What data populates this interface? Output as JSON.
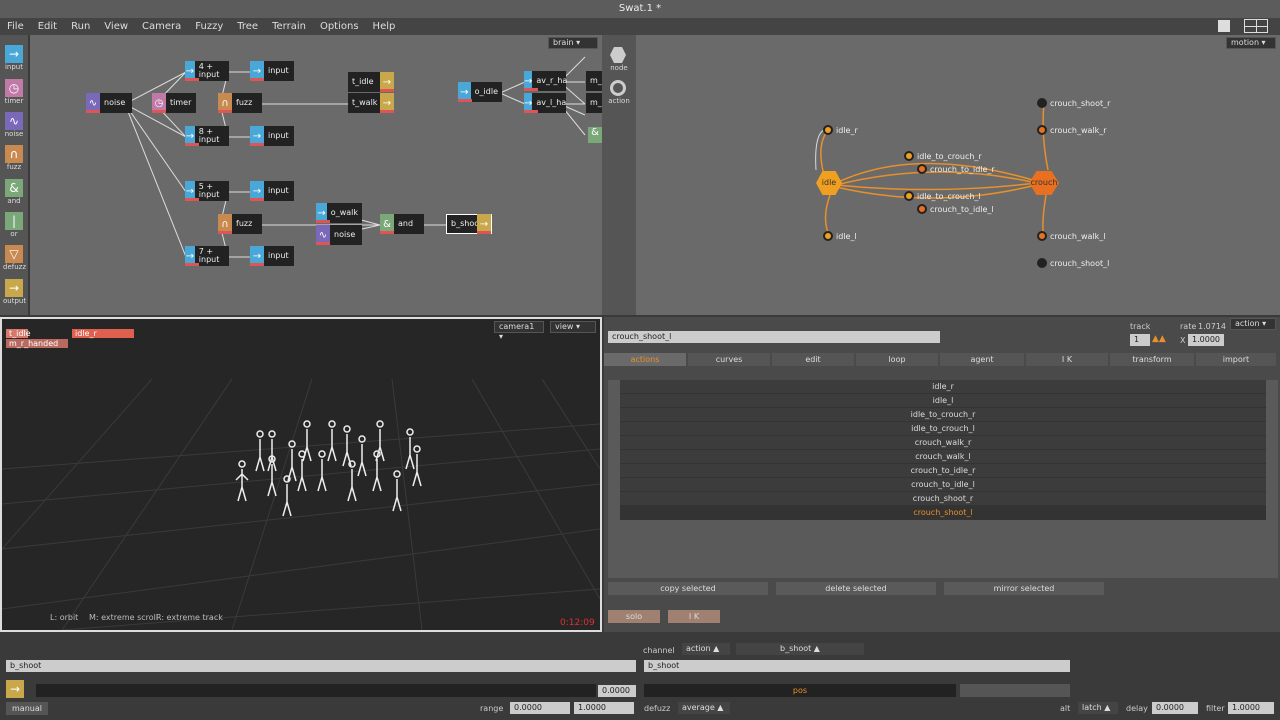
{
  "window": {
    "title": "Swat.1 *"
  },
  "menu": [
    "File",
    "Edit",
    "Run",
    "View",
    "Camera",
    "Fuzzy",
    "Tree",
    "Terrain",
    "Options",
    "Help"
  ],
  "tools": [
    {
      "label": "input",
      "icon": "arrow-right-icon"
    },
    {
      "label": "timer",
      "icon": "clock-icon"
    },
    {
      "label": "noise",
      "icon": "wave-icon"
    },
    {
      "label": "fuzz",
      "icon": "bell-curve-icon"
    },
    {
      "label": "and",
      "icon": "ampersand-icon"
    },
    {
      "label": "or",
      "icon": "bar-icon"
    },
    {
      "label": "defuzz",
      "icon": "triangle-down-icon"
    },
    {
      "label": "output",
      "icon": "arrow-right-icon"
    }
  ],
  "brain": {
    "dropdown": "brain",
    "nodes": {
      "noise": "noise",
      "timer": "timer",
      "in4": "4 + input",
      "in8": "8 + input",
      "in5": "5 + input",
      "in7": "7 + input",
      "input": "input",
      "fuzz": "fuzz",
      "t_idle": "t_idle",
      "t_walk": "t_walk",
      "o_idle": "o_idle",
      "av_r": "av_r_ha",
      "av_l": "av_l_ha",
      "m": "m_",
      "o_walk": "o_walk",
      "noise2": "noise",
      "and": "and",
      "b_shoot": "b_shoot"
    }
  },
  "side_tools": {
    "node": "node",
    "action": "action"
  },
  "motion": {
    "dropdown": "motion",
    "nodes": {
      "idle": "idle",
      "crouch": "crouch",
      "idle_r": "idle_r",
      "idle_l": "idle_l",
      "idle_to_crouch_r": "idle_to_crouch_r",
      "crouch_to_idle_r": "crouch_to_idle_r",
      "idle_to_crouch_l": "idle_to_crouch_l",
      "crouch_to_idle_l": "crouch_to_idle_l",
      "crouch_shoot_r": "crouch_shoot_r",
      "crouch_walk_r": "crouch_walk_r",
      "crouch_walk_l": "crouch_walk_l",
      "crouch_shoot_l": "crouch_shoot_l"
    }
  },
  "viewport": {
    "tags": [
      "t_idle",
      "idle_r",
      "m_r_handed"
    ],
    "camera": "camera1",
    "view": "view",
    "hint_orbit": "L: orbit",
    "hint_scroll": "M: extreme scroll",
    "hint_track": "R: extreme track",
    "timecode": "0:12:09"
  },
  "actions": {
    "name": "crouch_shoot_l",
    "track_label": "track",
    "track_value": "1",
    "rate_label": "rate",
    "rate_value": "1.0714",
    "x_label": "X",
    "x_value": "1.0000",
    "mode": "action",
    "tabs": [
      "actions",
      "curves",
      "edit",
      "loop",
      "agent",
      "I K",
      "transform",
      "import"
    ],
    "list": [
      "idle_r",
      "idle_l",
      "idle_to_crouch_r",
      "idle_to_crouch_l",
      "crouch_walk_r",
      "crouch_walk_l",
      "crouch_to_idle_r",
      "crouch_to_idle_l",
      "crouch_shoot_r",
      "crouch_shoot_l"
    ],
    "selected_index": 9,
    "buttons": {
      "copy": "copy selected",
      "delete": "delete selected",
      "mirror": "mirror selected",
      "solo": "solo",
      "ik": "I K"
    }
  },
  "bottom": {
    "left_field": "b_shoot",
    "channel_label": "channel",
    "channel_mode": "action",
    "channel_value": "b_shoot",
    "right_field": "b_shoot",
    "value": "0.0000",
    "pos": "pos",
    "manual": "manual",
    "range_label": "range",
    "range_min": "0.0000",
    "range_max": "1.0000",
    "defuzz_label": "defuzz",
    "defuzz_value": "average",
    "alt_label": "alt",
    "latch": "latch",
    "delay_label": "delay",
    "delay_value": "0.0000",
    "filter_label": "filter",
    "filter_value": "1.0000"
  },
  "colors": {
    "accent_orange": "#e8902a",
    "selected_text": "#e8902a"
  }
}
